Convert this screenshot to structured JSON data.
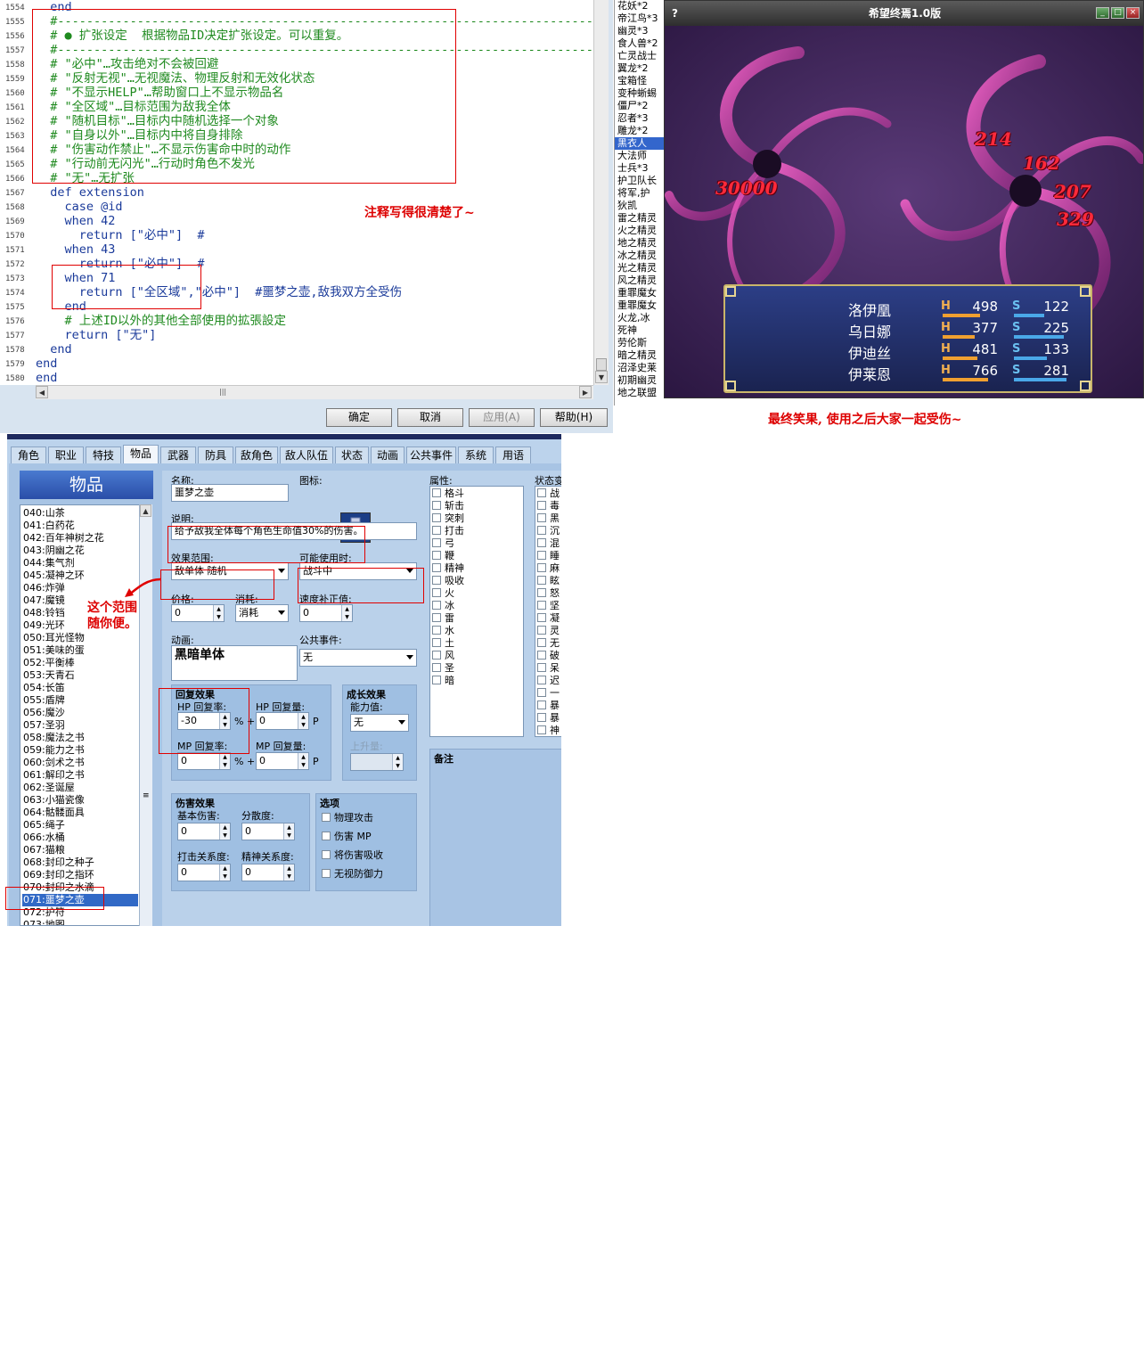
{
  "editor": {
    "lines": [
      {
        "num": "1554",
        "code": "  end",
        "cls": "kw"
      },
      {
        "num": "1555",
        "code": "  #--------------------------------------------------------------------------",
        "cls": "cm"
      },
      {
        "num": "1556",
        "code": "  # ● 扩张设定  根据物品ID决定扩张设定。可以重复。",
        "cls": "cm"
      },
      {
        "num": "1557",
        "code": "  #--------------------------------------------------------------------------",
        "cls": "cm"
      },
      {
        "num": "1558",
        "code": "  # \"必中\"…攻击绝对不会被回避",
        "cls": "cm"
      },
      {
        "num": "1559",
        "code": "  # \"反射无视\"…无视魔法、物理反射和无效化状态",
        "cls": "cm"
      },
      {
        "num": "1560",
        "code": "  # \"不显示HELP\"…帮助窗口上不显示物品名",
        "cls": "cm"
      },
      {
        "num": "1561",
        "code": "  # \"全区域\"…目标范围为敌我全体",
        "cls": "cm"
      },
      {
        "num": "1562",
        "code": "  # \"随机目标\"…目标内中随机选择一个对象",
        "cls": "cm"
      },
      {
        "num": "1563",
        "code": "  # \"自身以外\"…目标内中将自身排除",
        "cls": "cm"
      },
      {
        "num": "1564",
        "code": "  # \"伤害动作禁止\"…不显示伤害命中时的动作",
        "cls": "cm"
      },
      {
        "num": "1565",
        "code": "  # \"行动前无闪光\"…行动时角色不发光",
        "cls": "cm"
      },
      {
        "num": "1566",
        "code": "  # \"无\"…无扩张",
        "cls": "cm"
      },
      {
        "num": "1567",
        "code": "  def extension",
        "cls": "kw"
      },
      {
        "num": "1568",
        "code": "    case @id",
        "cls": "kw"
      },
      {
        "num": "1569",
        "code": "    when 42",
        "cls": "kw"
      },
      {
        "num": "1570",
        "code": "      return [\"必中\"]  #",
        "cls": "kw"
      },
      {
        "num": "1571",
        "code": "    when 43",
        "cls": "kw"
      },
      {
        "num": "1572",
        "code": "      return [\"必中\"]  #",
        "cls": "kw"
      },
      {
        "num": "1573",
        "code": "    when 71",
        "cls": "kw"
      },
      {
        "num": "1574",
        "code": "      return [\"全区域\",\"必中\"]  #噩梦之壶,敌我双方全受伤",
        "cls": "kw"
      },
      {
        "num": "1575",
        "code": "    end",
        "cls": "kw"
      },
      {
        "num": "1576",
        "code": "    # 上述ID以外的其他全部使用的拡張設定",
        "cls": "cm"
      },
      {
        "num": "1577",
        "code": "    return [\"无\"]",
        "cls": "kw"
      },
      {
        "num": "1578",
        "code": "  end",
        "cls": "kw"
      },
      {
        "num": "1579",
        "code": "end",
        "cls": "kw"
      },
      {
        "num": "1580",
        "code": "end",
        "cls": "kw"
      }
    ],
    "note": "注释写得很清楚了~",
    "buttons": {
      "ok": "确定",
      "cancel": "取消",
      "apply": "应用(A)",
      "help": "帮助(H)"
    }
  },
  "monsters": {
    "items": [
      "花妖*2",
      "帝江鸟*3",
      "幽灵*3",
      "食人兽*2",
      "亡灵战士",
      "翼龙*2",
      "宝箱怪",
      "变种蜥蜴",
      "僵尸*2",
      "忍者*3",
      "雕龙*2",
      "黑衣人",
      "大法师",
      "士兵*3",
      "护卫队长",
      "将军,护",
      "狄凯",
      "雷之精灵",
      "火之精灵",
      "地之精灵",
      "冰之精灵",
      "光之精灵",
      "风之精灵",
      "重罪魔女",
      "重罪魔女",
      "火龙,冰",
      "死神",
      "劳伦斯",
      "暗之精灵",
      "沼泽史莱",
      "初期幽灵",
      "地之联盟"
    ],
    "selected_index": 11
  },
  "game": {
    "title": "希望终焉1.0版",
    "damages": [
      "30000",
      "214",
      "162",
      "207",
      "329"
    ],
    "party": [
      {
        "name": "洛伊凰",
        "hp": "498",
        "sp": "122",
        "hp_ratio": 0.7,
        "sp_ratio": 0.55
      },
      {
        "name": "乌日娜",
        "hp": "377",
        "sp": "225",
        "hp_ratio": 0.6,
        "sp_ratio": 0.9
      },
      {
        "name": "伊迪丝",
        "hp": "481",
        "sp": "133",
        "hp_ratio": 0.65,
        "sp_ratio": 0.6
      },
      {
        "name": "伊莱恩",
        "hp": "766",
        "sp": "281",
        "hp_ratio": 0.85,
        "sp_ratio": 0.95
      }
    ],
    "hp_label": "H",
    "sp_label": "S",
    "caption": "最终笑果, 使用之后大家一起受伤~"
  },
  "db": {
    "tabs": [
      "角色",
      "职业",
      "特技",
      "物品",
      "武器",
      "防具",
      "敌角色",
      "敌人队伍",
      "状态",
      "动画",
      "公共事件",
      "系统",
      "用语"
    ],
    "active_tab": 3,
    "list_title": "物品",
    "items": [
      "040:山茶",
      "041:白药花",
      "042:百年神树之花",
      "043:阴幽之花",
      "044:集气剂",
      "045:凝神之环",
      "046:炸弹",
      "047:魔镜",
      "048:铃铛",
      "049:光环",
      "050:耳光怪物",
      "051:美味的蛋",
      "052:平衡棒",
      "053:天青石",
      "054:长笛",
      "055:盾牌",
      "056:魔沙",
      "057:圣羽",
      "058:魔法之书",
      "059:能力之书",
      "060:剑术之书",
      "061:解印之书",
      "062:圣诞屋",
      "063:小猫瓷像",
      "064:骷髅面具",
      "065:绳子",
      "066:水桶",
      "067:猫粮",
      "068:封印之种子",
      "069:封印之指环",
      "070:封印之水滴",
      "071:噩梦之壶",
      "072:护符",
      "073:地图"
    ],
    "selected_item": 31,
    "range_note": "这个范围\n随你便。",
    "labels": {
      "name": "名称:",
      "icon": "图标:",
      "desc": "说明:",
      "scope": "效果范围:",
      "occasion": "可能使用时:",
      "price": "价格:",
      "consume": "消耗:",
      "speed": "速度补正值:",
      "anim": "动画:",
      "common": "公共事件:",
      "recover": "回复效果",
      "hp_rate": "HP 回复率:",
      "hp_amt": "HP 回复量:",
      "mp_rate": "MP 回复率:",
      "mp_amt": "MP 回复量:",
      "growth": "成长效果",
      "param": "能力值:",
      "rise": "上升量:",
      "damage": "伤害效果",
      "base_dmg": "基本伤害:",
      "variance": "分散度:",
      "atk_rel": "打击关系度:",
      "spi_rel": "精神关系度:",
      "options": "选项",
      "attr": "属性:",
      "state": "状态变",
      "memo": "备注",
      "pct": "% +",
      "p": "P"
    },
    "values": {
      "name": "噩梦之壶",
      "desc": "给予敌我全体每个角色生命值30%的伤害。",
      "scope": "敌单体 随机",
      "occasion": "战斗中",
      "price": "0",
      "consume": "消耗",
      "speed": "0",
      "anim": "黑暗单体",
      "common": "无",
      "hp_rate": "-30",
      "hp_amt": "0",
      "mp_rate": "0",
      "mp_amt": "0",
      "param": "无",
      "base_dmg": "0",
      "variance": "0",
      "atk_rel": "0",
      "spi_rel": "0"
    },
    "options": [
      "物理攻击",
      "伤害 MP",
      "将伤害吸收",
      "无视防御力"
    ],
    "attributes": [
      "格斗",
      "斩击",
      "突刺",
      "打击",
      "弓",
      "鞭",
      "精神",
      "吸收",
      "火",
      "冰",
      "雷",
      "水",
      "土",
      "风",
      "圣",
      "暗"
    ],
    "states": [
      "战",
      "毒",
      "黑",
      "沉",
      "混",
      "睡",
      "麻",
      "眩",
      "怒",
      "坚",
      "凝",
      "灵",
      "无",
      "破",
      "呆",
      "迟",
      "一",
      "暴",
      "暴",
      "神"
    ]
  },
  "colors": {
    "comment": "#1f8a1f",
    "keyword": "#1a3a9a",
    "annotation": "#dd0000",
    "hp_bar": "#f0a030",
    "sp_bar": "#4aa8e8",
    "selection": "#3169c6"
  }
}
